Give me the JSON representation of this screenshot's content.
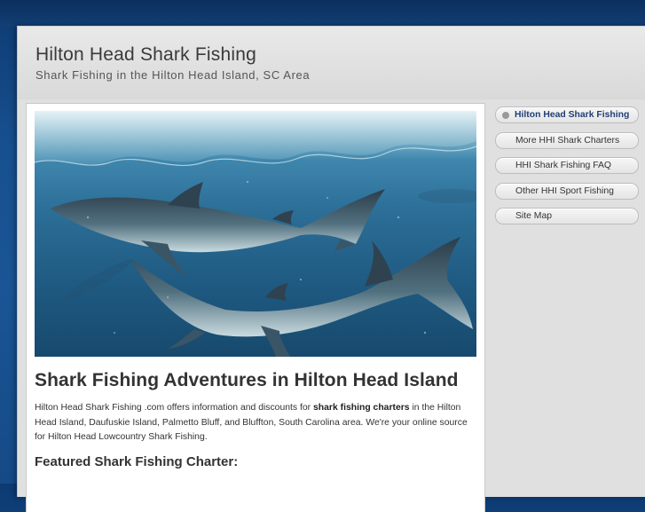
{
  "header": {
    "title": "Hilton Head Shark Fishing",
    "tagline": "Shark Fishing in the Hilton Head Island, SC Area"
  },
  "nav": {
    "items": [
      {
        "label": "Hilton Head Shark Fishing",
        "active": true
      },
      {
        "label": "More HHI Shark Charters",
        "active": false
      },
      {
        "label": "HHI Shark Fishing FAQ",
        "active": false
      },
      {
        "label": "Other HHI Sport Fishing",
        "active": false
      },
      {
        "label": "Site Map",
        "active": false
      }
    ]
  },
  "main": {
    "heading": "Shark Fishing Adventures in Hilton Head Island",
    "intro_before": "Hilton Head Shark Fishing .com offers information and discounts for ",
    "intro_bold": "shark fishing charters",
    "intro_after": " in the Hilton Head Island, Daufuskie Island, Palmetto Bluff, and Bluffton, South Carolina area. We're your online source for Hilton Head Lowcountry Shark Fishing.",
    "featured_heading": "Featured Shark Fishing Charter:"
  },
  "colors": {
    "background": "#17508f",
    "page": "#e0e0e0",
    "active_nav_text": "#1f3f73"
  }
}
